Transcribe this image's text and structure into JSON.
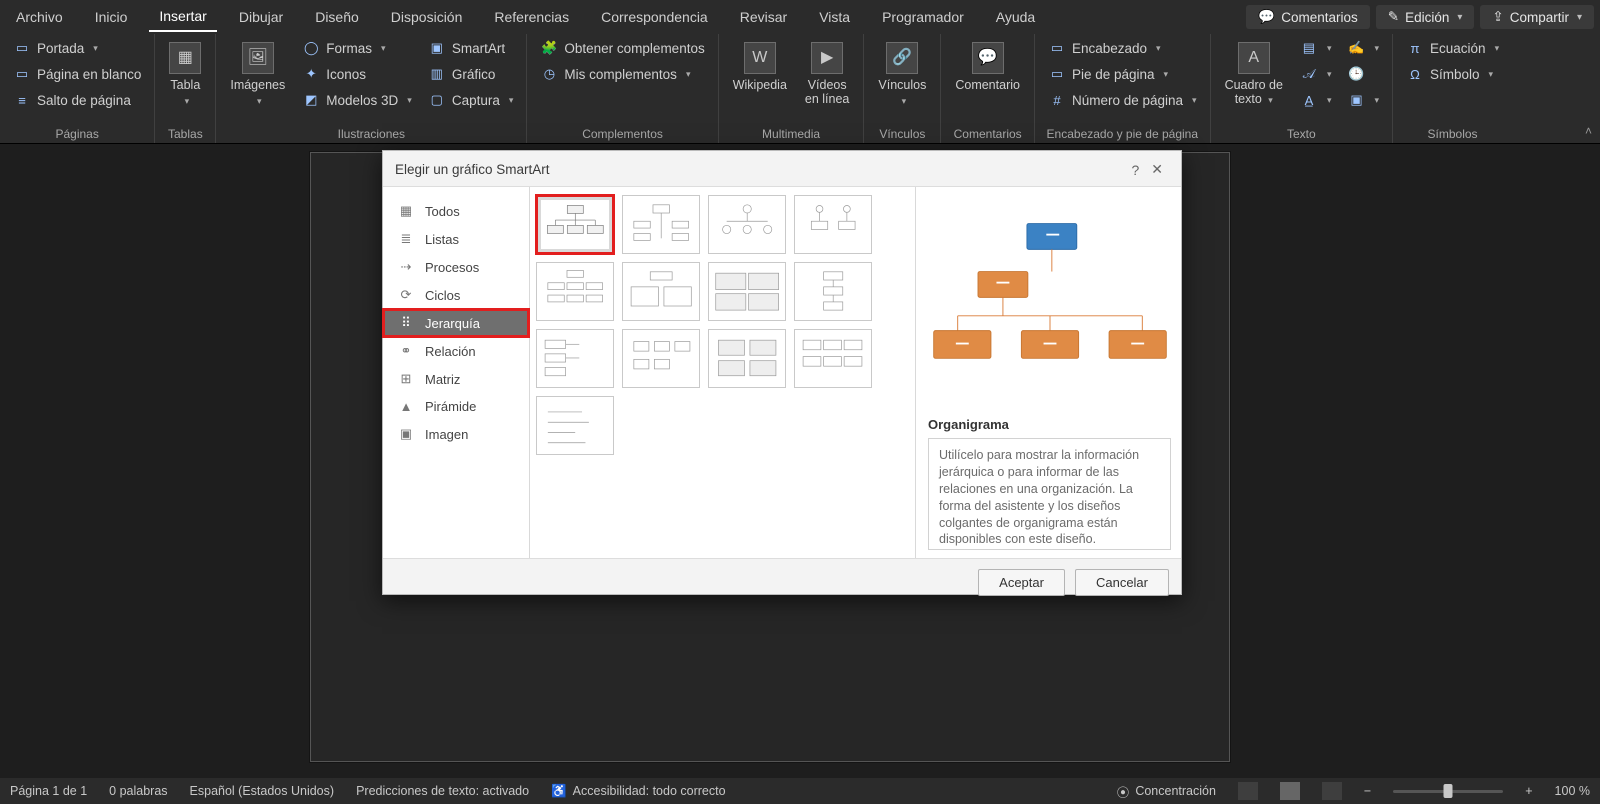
{
  "tabs": {
    "items": [
      "Archivo",
      "Inicio",
      "Insertar",
      "Dibujar",
      "Diseño",
      "Disposición",
      "Referencias",
      "Correspondencia",
      "Revisar",
      "Vista",
      "Programador",
      "Ayuda"
    ],
    "active_index": 2
  },
  "title_actions": {
    "comments": "Comentarios",
    "editing": "Edición",
    "share": "Compartir"
  },
  "ribbon": {
    "pages": {
      "label": "Páginas",
      "items": [
        "Portada",
        "Página en blanco",
        "Salto de página"
      ]
    },
    "tables": {
      "label": "Tablas",
      "button": "Tabla"
    },
    "illustrations": {
      "label": "Ilustraciones",
      "images": "Imágenes",
      "shapes": "Formas",
      "icons": "Iconos",
      "models3d": "Modelos 3D",
      "smartart": "SmartArt",
      "chart": "Gráfico",
      "screenshot": "Captura"
    },
    "addins": {
      "label": "Complementos",
      "get": "Obtener complementos",
      "mine": "Mis complementos"
    },
    "multimedia": {
      "label": "Multimedia",
      "wikipedia": "Wikipedia",
      "videos_line1": "Vídeos",
      "videos_line2": "en línea"
    },
    "links": {
      "label": "Vínculos",
      "button": "Vínculos"
    },
    "comments": {
      "label": "Comentarios",
      "button": "Comentario"
    },
    "headerfooter": {
      "label": "Encabezado y pie de página",
      "header": "Encabezado",
      "footer": "Pie de página",
      "pagenum": "Número de página"
    },
    "text": {
      "label": "Texto",
      "textbox_line1": "Cuadro de",
      "textbox_line2": "texto"
    },
    "symbols": {
      "label": "Símbolos",
      "equation": "Ecuación",
      "symbol": "Símbolo"
    }
  },
  "dialog": {
    "title": "Elegir un gráfico SmartArt",
    "categories": [
      "Todos",
      "Listas",
      "Procesos",
      "Ciclos",
      "Jerarquía",
      "Relación",
      "Matriz",
      "Pirámide",
      "Imagen"
    ],
    "selected_category_index": 4,
    "preview_title": "Organigrama",
    "preview_desc": "Utilícelo para mostrar la información jerárquica o para informar de las relaciones en una organización. La forma del asistente y los diseños colgantes de organigrama están disponibles con este diseño.",
    "ok": "Aceptar",
    "cancel": "Cancelar"
  },
  "status": {
    "page": "Página 1 de 1",
    "words": "0 palabras",
    "language": "Español (Estados Unidos)",
    "predictions": "Predicciones de texto: activado",
    "accessibility": "Accesibilidad: todo correcto",
    "focus": "Concentración",
    "zoom_value": "100 %"
  }
}
